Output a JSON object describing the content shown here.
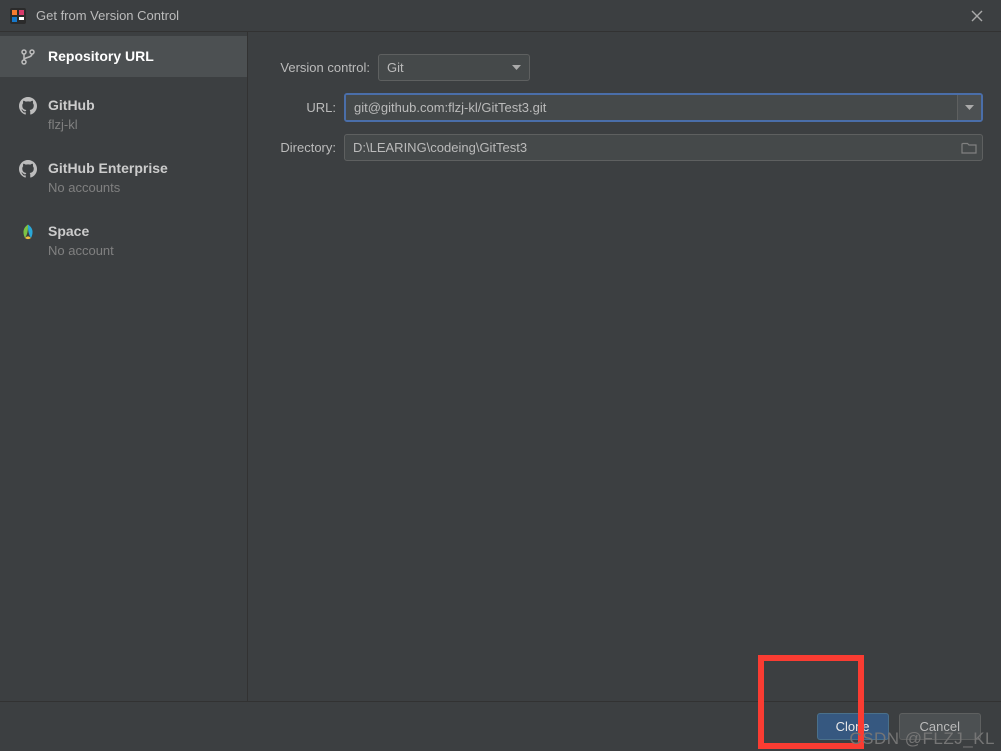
{
  "titlebar": {
    "title": "Get from Version Control"
  },
  "sidebar": {
    "items": [
      {
        "title": "Repository URL",
        "sub": ""
      },
      {
        "title": "GitHub",
        "sub": "flzj-kl"
      },
      {
        "title": "GitHub Enterprise",
        "sub": "No accounts"
      },
      {
        "title": "Space",
        "sub": "No account"
      }
    ]
  },
  "form": {
    "vc_label": "Version control:",
    "vc_value": "Git",
    "url_label": "URL:",
    "url_value": "git@github.com:flzj-kl/GitTest3.git",
    "dir_label": "Directory:",
    "dir_value": "D:\\LEARING\\codeing\\GitTest3"
  },
  "footer": {
    "clone": "Clone",
    "cancel": "Cancel"
  },
  "watermark": "CSDN @FLZJ_KL",
  "colors": {
    "accent": "#365880",
    "highlight": "#fa3c32"
  }
}
